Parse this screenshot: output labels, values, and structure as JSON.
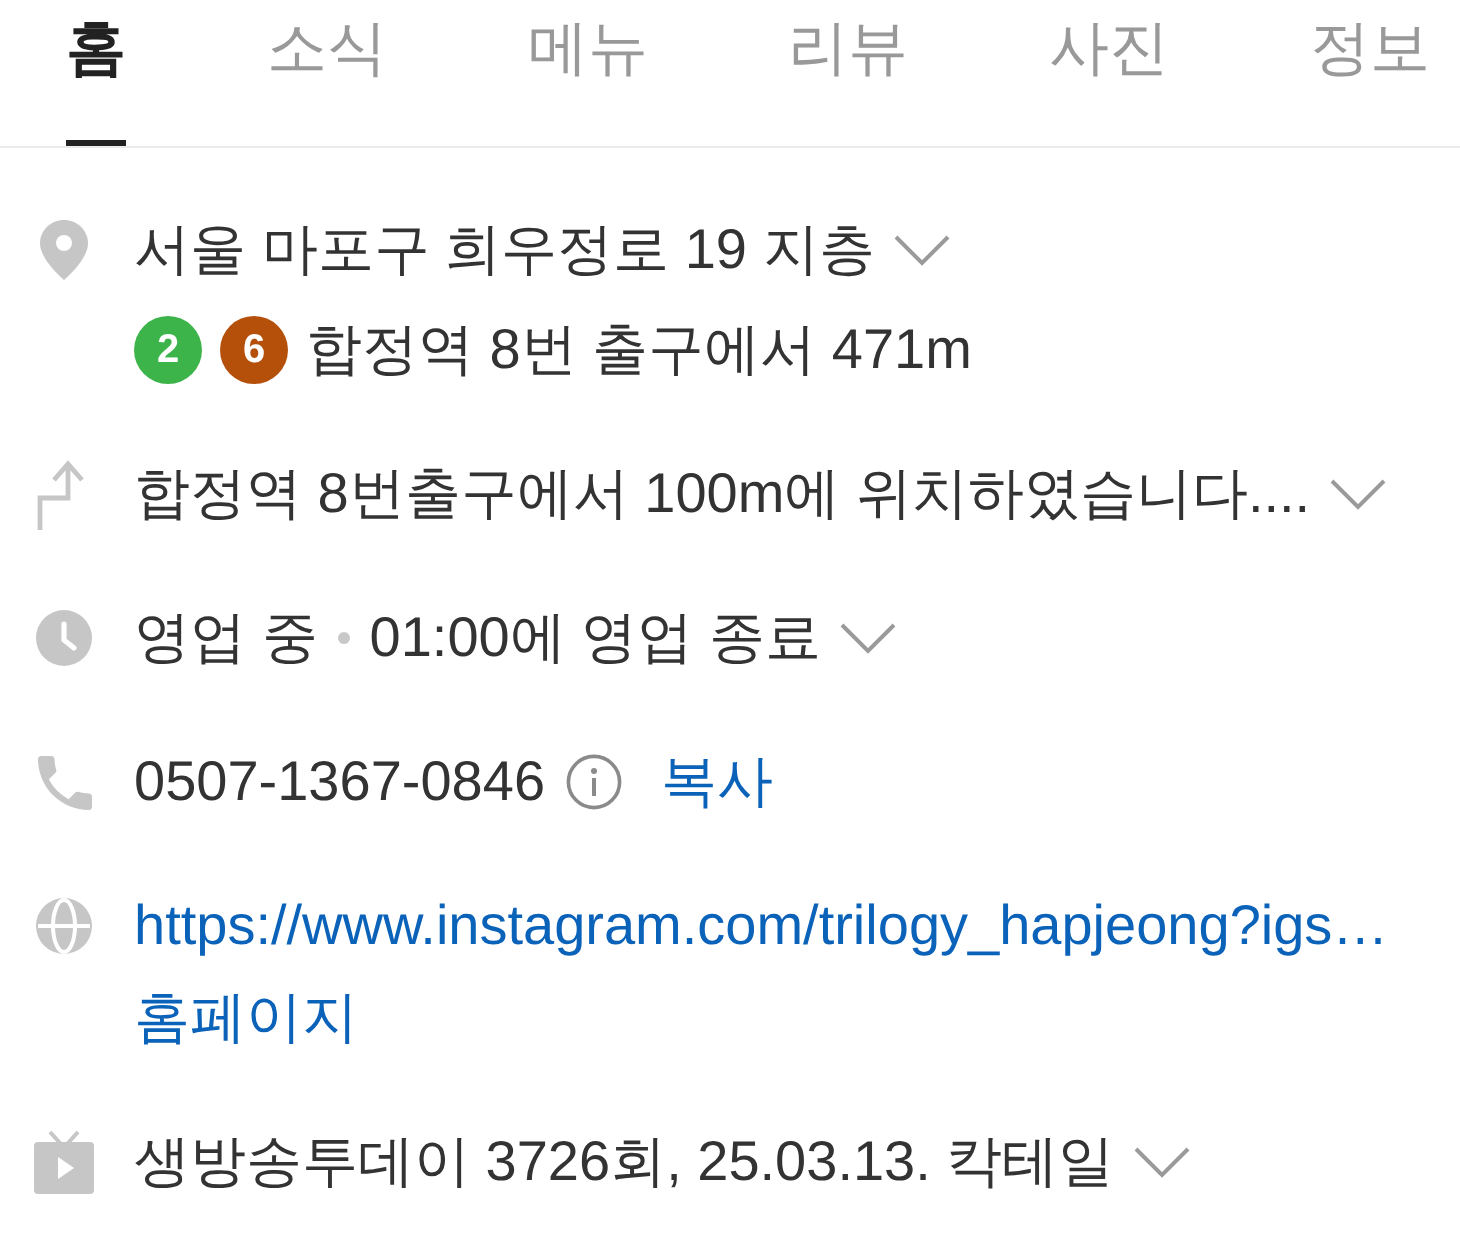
{
  "tabs": [
    {
      "label": "홈",
      "selected": true
    },
    {
      "label": "소식",
      "selected": false
    },
    {
      "label": "메뉴",
      "selected": false
    },
    {
      "label": "리뷰",
      "selected": false
    },
    {
      "label": "사진",
      "selected": false
    },
    {
      "label": "정보",
      "selected": false
    }
  ],
  "info_rows": [
    {
      "kind": "address",
      "text": "서울 마포구 희우정로 19 지층",
      "expandable": true,
      "subway_lines": [
        {
          "number": "2",
          "color": "#3cb44a"
        },
        {
          "number": "6",
          "color": "#b5500b"
        }
      ],
      "station_text": "합정역 8번 출구에서 471m"
    },
    {
      "kind": "directions",
      "text": "합정역 8번출구에서 100m에 위치하였습니다....",
      "expandable": true
    },
    {
      "kind": "hours",
      "status": "영업 중",
      "text": "01:00에 영업 종료",
      "expandable": true
    },
    {
      "kind": "phone",
      "text": "0507-1367-0846",
      "action": "복사",
      "expandable": false
    },
    {
      "kind": "website",
      "url": "https://www.instagram.com/trilogy_hapjeong?igs…",
      "link": "홈페이지",
      "expandable": false
    },
    {
      "kind": "tv",
      "text": "생방송투데이 3726회, 25.03.13. 칵테일",
      "expandable": true
    }
  ]
}
